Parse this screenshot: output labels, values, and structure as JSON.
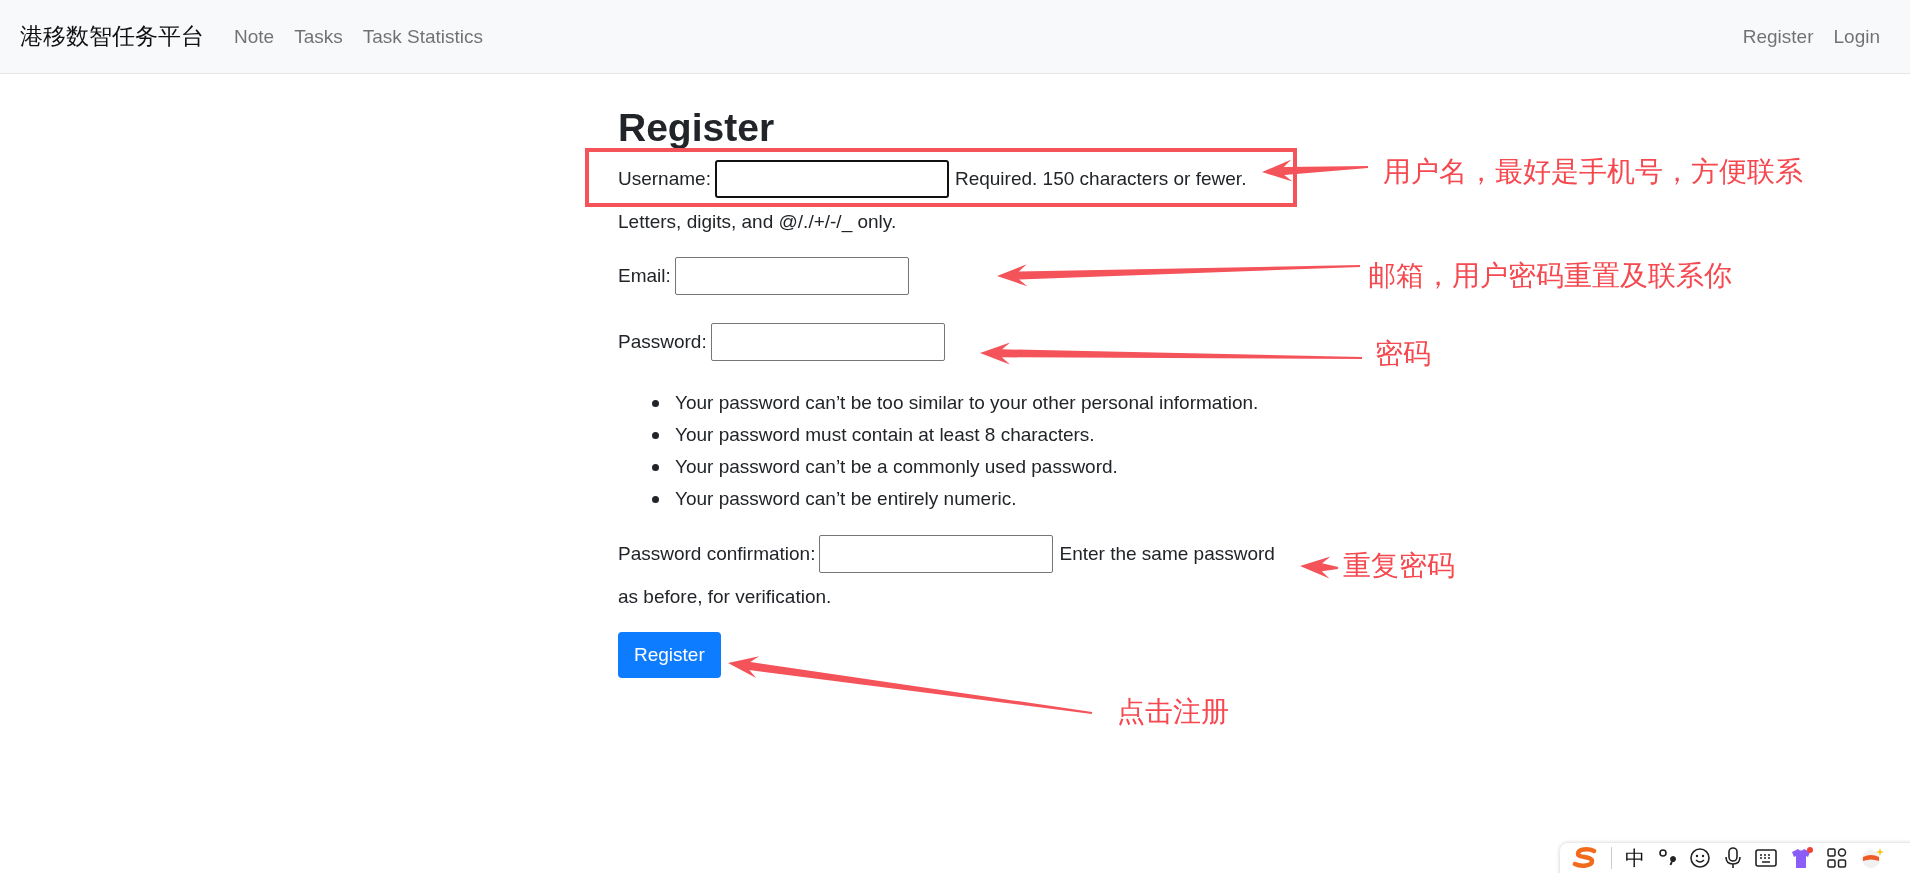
{
  "navbar": {
    "brand": "港移数智任务平台",
    "links": [
      {
        "label": "Note"
      },
      {
        "label": "Tasks"
      },
      {
        "label": "Task Statistics"
      }
    ],
    "right_links": [
      {
        "label": "Register"
      },
      {
        "label": "Login"
      }
    ]
  },
  "form": {
    "title": "Register",
    "fields": [
      {
        "label": "Username:",
        "focused": true,
        "help": [
          "Required. 150 characters or fewer.",
          "Letters, digits, and @/./+/-/_ only."
        ]
      },
      {
        "label": "Email:",
        "focused": false
      },
      {
        "label": "Password:",
        "focused": false
      },
      {
        "label": "Password confirmation:",
        "focused": false,
        "help": [
          "Enter the same password",
          "as before, for verification."
        ]
      }
    ],
    "password_rules": [
      "Your password can’t be too similar to your other personal information.",
      "Your password must contain at least 8 characters.",
      "Your password can’t be a commonly used password.",
      "Your password can’t be entirely numeric."
    ],
    "submit": "Register"
  },
  "annotations": [
    {
      "text": "用户名，最好是手机号，方便联系"
    },
    {
      "text": "邮箱，用户密码重置及联系你"
    },
    {
      "text": "密码"
    },
    {
      "text": "重复密码"
    },
    {
      "text": "点击注册"
    }
  ],
  "ime_toolbar": {
    "mode": "中"
  }
}
